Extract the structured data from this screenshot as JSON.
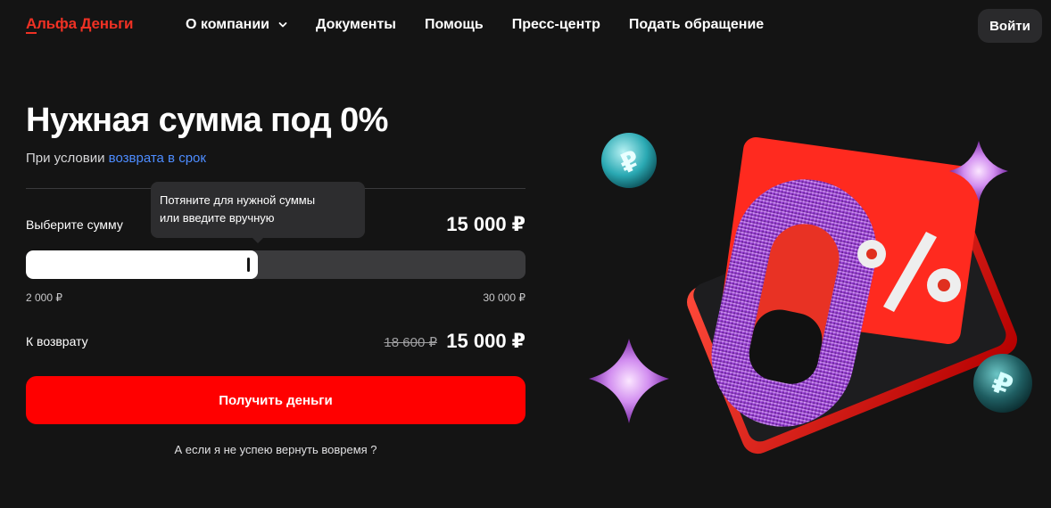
{
  "header": {
    "logo": "Альфа Деньги",
    "nav": [
      {
        "label": "О компании",
        "has_dropdown": true
      },
      {
        "label": "Документы"
      },
      {
        "label": "Помощь"
      },
      {
        "label": "Пресс-центр"
      },
      {
        "label": "Подать обращение"
      }
    ],
    "login_label": "Войти"
  },
  "hero": {
    "title": "Нужная сумма под 0%",
    "subtitle_prefix": "При условии ",
    "subtitle_link": "возврата в срок"
  },
  "calculator": {
    "tooltip_line1": "Потяните для нужной суммы",
    "tooltip_line2": "или введите вручную",
    "choose_label": "Выберите сумму",
    "amount": "15 000 ₽",
    "slider": {
      "min_label": "2 000 ₽",
      "max_label": "30 000 ₽",
      "min": 2000,
      "max": 30000,
      "value": 15000
    },
    "return_label": "К возврату",
    "old_return_amount": "18 600 ₽",
    "return_amount": "15 000 ₽",
    "cta_label": "Получить деньги",
    "faq_link": "А если я не успею вернуть вовремя ?"
  },
  "illustration": {
    "text": "0%"
  },
  "colors": {
    "accent": "#ff0000",
    "brand": "#ef3124",
    "link": "#4d8cff",
    "background": "#141414"
  }
}
